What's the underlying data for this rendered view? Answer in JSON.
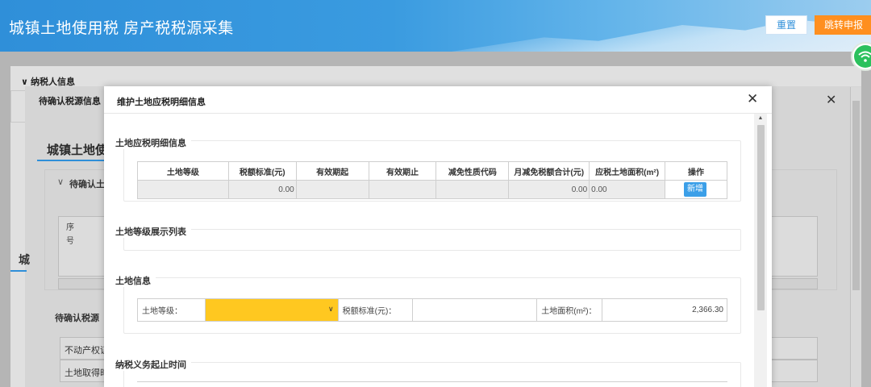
{
  "header": {
    "title": "城镇土地使用税 房产税税源采集",
    "reset_label": "重置",
    "jump_label": "跳转申报"
  },
  "background": {
    "taxpayer_section": "纳税人信息",
    "dialog_title": "待确认税源信息",
    "tab_title": "城镇土地使",
    "confirm_section": "待确认土",
    "seq_header": "序号",
    "pending_section": "待确认税源",
    "row1_label": "不动产权证",
    "row2_label": "土地取得时",
    "side_char": "城"
  },
  "modal": {
    "title": "维护土地应税明细信息",
    "detail_section": {
      "title": "土地应税明细信息",
      "headers": [
        "土地等级",
        "税额标准(元)",
        "有效期起",
        "有效期止",
        "减免性质代码",
        "月减免税额合计(元)",
        "应税土地面积(m²)",
        "操作"
      ],
      "row": [
        "",
        "0.00",
        "",
        "",
        "",
        "0.00",
        "0.00"
      ],
      "add_label": "新增"
    },
    "grade_section": {
      "title": "土地等级展示列表"
    },
    "land_section": {
      "title": "土地信息",
      "grade_label": "土地等级：",
      "grade_value": "",
      "tax_std_label": "税额标准(元)：",
      "tax_std_value": "",
      "area_label": "土地面积(m²)：",
      "area_value": "2,366.30"
    },
    "obligation_section": {
      "title": "纳税义务起止时间"
    }
  },
  "colors": {
    "header_blue": "#2f8fd9",
    "jump_orange": "#ff8f1f",
    "select_yellow": "#ffc820",
    "add_button_blue": "#3b9fe8",
    "wifi_green": "#2bc15d"
  }
}
